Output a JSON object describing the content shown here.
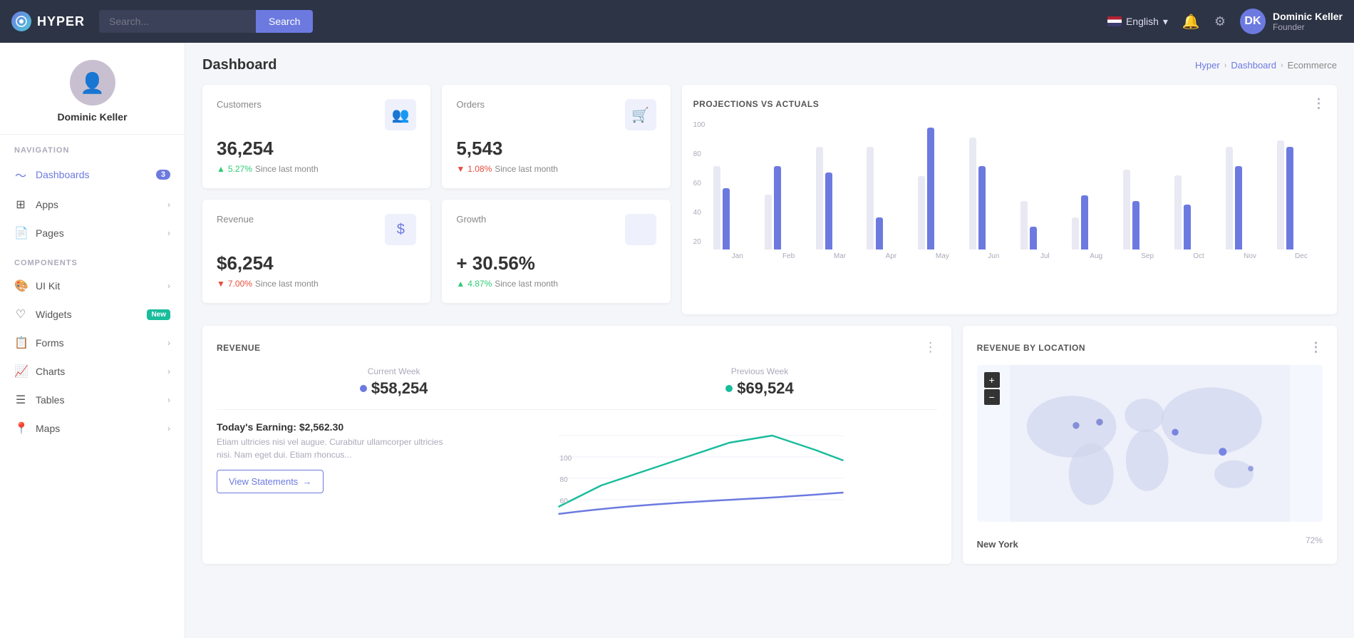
{
  "app": {
    "logo_text": "HYPER",
    "logo_icon": "○"
  },
  "topbar": {
    "search_placeholder": "Search...",
    "search_button": "Search",
    "language": "English",
    "user_name": "Dominic Keller",
    "user_role": "Founder"
  },
  "sidebar": {
    "username": "Dominic Keller",
    "nav_label": "NAVIGATION",
    "components_label": "COMPONENTS",
    "nav_items": [
      {
        "id": "dashboards",
        "label": "Dashboards",
        "icon": "📊",
        "badge": "3",
        "arrow": false
      },
      {
        "id": "apps",
        "label": "Apps",
        "icon": "⊞",
        "badge": null,
        "arrow": true
      },
      {
        "id": "pages",
        "label": "Pages",
        "icon": "📄",
        "badge": null,
        "arrow": true
      }
    ],
    "component_items": [
      {
        "id": "ui-kit",
        "label": "UI Kit",
        "icon": "🎨",
        "badge": null,
        "arrow": true
      },
      {
        "id": "widgets",
        "label": "Widgets",
        "icon": "♡",
        "badge_new": "New",
        "arrow": false
      },
      {
        "id": "forms",
        "label": "Forms",
        "icon": "📋",
        "badge": null,
        "arrow": true
      },
      {
        "id": "charts",
        "label": "Charts",
        "icon": "📈",
        "badge": null,
        "arrow": true
      },
      {
        "id": "tables",
        "label": "Tables",
        "icon": "☰",
        "badge": null,
        "arrow": true
      },
      {
        "id": "maps",
        "label": "Maps",
        "icon": "📍",
        "badge": null,
        "arrow": true
      }
    ]
  },
  "page": {
    "title": "Dashboard",
    "breadcrumb": [
      "Hyper",
      "Dashboard",
      "Ecommerce"
    ]
  },
  "stats": {
    "customers": {
      "label": "Customers",
      "value": "36,254",
      "change": "5.27%",
      "change_dir": "up",
      "change_label": "Since last month"
    },
    "orders": {
      "label": "Orders",
      "value": "5,543",
      "change": "1.08%",
      "change_dir": "down",
      "change_label": "Since last month"
    },
    "revenue": {
      "label": "Revenue",
      "value": "$6,254",
      "change": "7.00%",
      "change_dir": "down",
      "change_label": "Since last month"
    },
    "growth": {
      "label": "Growth",
      "value": "+ 30.56%",
      "change": "4.87%",
      "change_dir": "up",
      "change_label": "Since last month"
    }
  },
  "projections_chart": {
    "title": "PROJECTIONS VS ACTUALS",
    "months": [
      "Jan",
      "Feb",
      "Mar",
      "Apr",
      "May",
      "Jun",
      "Jul",
      "Aug",
      "Sep",
      "Oct",
      "Nov",
      "Dec"
    ],
    "projected": [
      65,
      43,
      80,
      80,
      57,
      87,
      38,
      25,
      62,
      58,
      80,
      85
    ],
    "actual": [
      48,
      65,
      60,
      25,
      95,
      65,
      18,
      42,
      38,
      35,
      65,
      80
    ],
    "y_labels": [
      "100",
      "80",
      "60",
      "40",
      "20"
    ]
  },
  "revenue_section": {
    "title": "REVENUE",
    "current_week_label": "Current Week",
    "current_week_value": "$58,254",
    "previous_week_label": "Previous Week",
    "previous_week_value": "$69,524",
    "earning_title": "Today's Earning: $2,562.30",
    "earning_desc": "Etiam ultricies nisi vel augue. Curabitur ullamcorper ultricies nisi. Nam eget dui. Etiam rhoncus...",
    "view_btn": "View Statements"
  },
  "map_section": {
    "title": "REVENUE BY LOCATION",
    "location_label": "New York",
    "location_value": "72%",
    "zoom_plus": "+",
    "zoom_minus": "−"
  }
}
